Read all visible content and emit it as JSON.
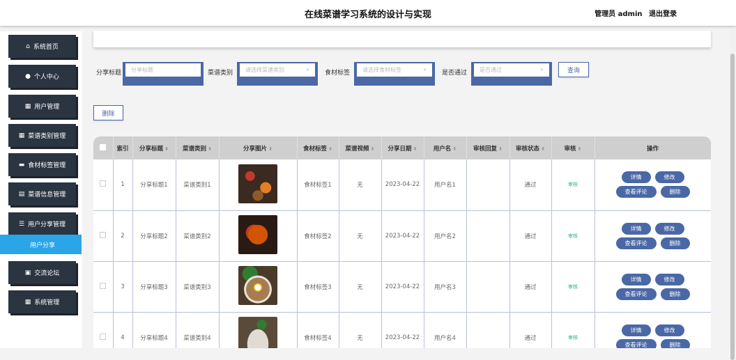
{
  "header": {
    "title": "在线菜谱学习系统的设计与实现",
    "user_label": "管理员 admin",
    "logout": "退出登录"
  },
  "sidebar": {
    "items": [
      {
        "label": "系统首页",
        "icon": "home-icon",
        "glyph": "⌂"
      },
      {
        "label": "个人中心",
        "icon": "user-icon",
        "glyph": "●"
      },
      {
        "label": "用户管理",
        "icon": "grid-icon",
        "glyph": "▦"
      },
      {
        "label": "菜谱类别管理",
        "icon": "grid-icon",
        "glyph": "▦"
      },
      {
        "label": "食材标签管理",
        "icon": "briefcase-icon",
        "glyph": "▬"
      },
      {
        "label": "菜谱信息管理",
        "icon": "clipboard-icon",
        "glyph": "▤"
      },
      {
        "label": "用户分享管理",
        "icon": "list-icon",
        "glyph": "☰"
      },
      {
        "label": "交流论坛",
        "icon": "check-clipboard-icon",
        "glyph": "▣"
      },
      {
        "label": "系统管理",
        "icon": "grid-icon",
        "glyph": "▦"
      }
    ],
    "active_sub": "用户分享"
  },
  "search": {
    "title_label": "分享标题",
    "title_placeholder": "分享标题",
    "category_label": "菜谱类别",
    "category_placeholder": "请选择菜谱类别",
    "tag_label": "食材标签",
    "tag_placeholder": "请选择食材标签",
    "pass_label": "是否通过",
    "pass_placeholder": "是否通过",
    "query_button": "查询"
  },
  "toolbar": {
    "delete_button": "删除"
  },
  "table": {
    "headers": [
      "",
      "索引",
      "分享标题",
      "菜谱类别",
      "分享图片",
      "食材标签",
      "菜谱视频",
      "分享日期",
      "用户名",
      "审核回复",
      "审核状态",
      "审核",
      "操作"
    ],
    "rows": [
      {
        "index": "1",
        "title": "分享标题1",
        "category": "菜谱类别1",
        "tag": "食材标签1",
        "video": "无",
        "date": "2023-04-22",
        "user": "用户名1",
        "reply": "",
        "status": "通过",
        "audit": "审核"
      },
      {
        "index": "2",
        "title": "分享标题2",
        "category": "菜谱类别2",
        "tag": "食材标签2",
        "video": "无",
        "date": "2023-04-22",
        "user": "用户名2",
        "reply": "",
        "status": "通过",
        "audit": "审核"
      },
      {
        "index": "3",
        "title": "分享标题3",
        "category": "菜谱类别3",
        "tag": "食材标签3",
        "video": "无",
        "date": "2023-04-22",
        "user": "用户名3",
        "reply": "",
        "status": "通过",
        "audit": "审核"
      },
      {
        "index": "4",
        "title": "分享标题4",
        "category": "菜谱类别4",
        "tag": "食材标签4",
        "video": "无",
        "date": "2023-04-22",
        "user": "用户名4",
        "reply": "",
        "status": "通过",
        "audit": "审核"
      }
    ],
    "actions": {
      "detail": "详情",
      "edit": "修改",
      "comments": "查看评论",
      "delete": "删除"
    }
  },
  "colors": {
    "accent": "#4a68a6",
    "sidebar_bg": "#2b3441",
    "active_sub": "#2aa5e8",
    "audit": "#2ab37a"
  }
}
